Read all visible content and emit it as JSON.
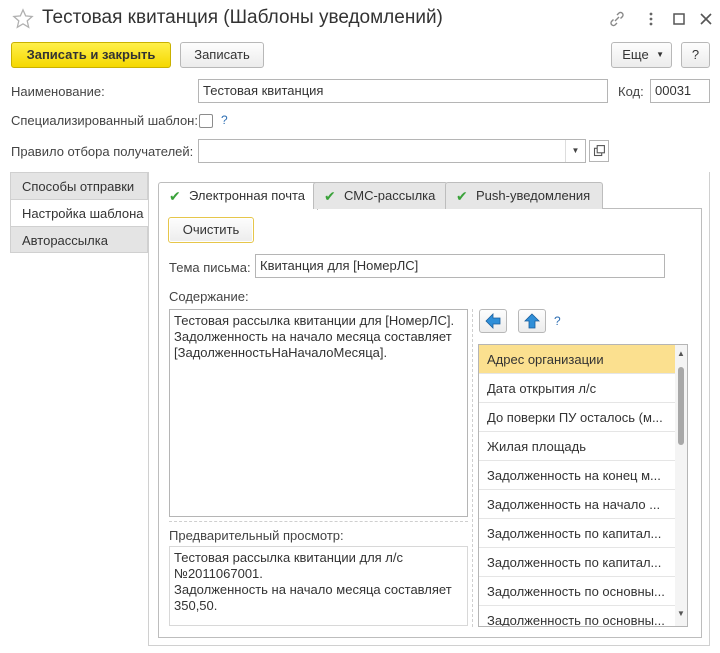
{
  "window": {
    "title": "Тестовая квитанция (Шаблоны уведомлений)",
    "icons": [
      "star-icon",
      "link-icon",
      "more-icon",
      "maximize-icon",
      "close-icon"
    ]
  },
  "toolbar": {
    "save_close_label": "Записать и закрыть",
    "save_label": "Записать",
    "more_label": "Еще",
    "help_label": "?"
  },
  "form": {
    "name_label": "Наименование:",
    "name_value": "Тестовая квитанция",
    "code_label": "Код:",
    "code_value": "00031",
    "special_template_label": "Специализированный шаблон:",
    "special_template_checked": false,
    "help_mark": "?",
    "filter_label": "Правило отбора получателей:",
    "filter_value": ""
  },
  "sidebar": {
    "items": [
      {
        "label": "Способы отправки",
        "active": false
      },
      {
        "label": "Настройка шаблона",
        "active": true
      },
      {
        "label": "Авторассылка",
        "active": false
      }
    ]
  },
  "tabs": [
    {
      "label": "Электронная почта",
      "active": true,
      "checked": true
    },
    {
      "label": "СМС-рассылка",
      "active": false,
      "checked": true
    },
    {
      "label": "Push-уведомления",
      "active": false,
      "checked": true
    }
  ],
  "email": {
    "clear_label": "Очистить",
    "subject_label": "Тема письма:",
    "subject_value": "Квитанция для [НомерЛС]",
    "content_label": "Содержание:",
    "content_value": "Тестовая рассылка квитанции для [НомерЛС].\nЗадолженность на начало месяца составляет\n[ЗадолженностьНаНачалоМесяца].",
    "preview_label": "Предварительный просмотр:",
    "preview_value": "Тестовая рассылка квитанции для л/с\n№2011067001.\nЗадолженность на начало месяца составляет\n350,50.",
    "help_mark": "?"
  },
  "fields_list": {
    "items": [
      "Адрес организации",
      "Дата открытия л/с",
      "До поверки ПУ осталось (м...",
      "Жилая площадь",
      "Задолженность на конец м...",
      "Задолженность на начало ...",
      "Задолженность по капитал...",
      "Задолженность по капитал...",
      "Задолженность по основны...",
      "Задолженность по основны..."
    ],
    "selected_index": 0
  },
  "colors": {
    "primary_button": "#f5d800",
    "selected_row": "#fbe08f",
    "check": "#3aa23a",
    "help": "#2f6fb3",
    "arrow_icon": "#2f8fd8"
  }
}
